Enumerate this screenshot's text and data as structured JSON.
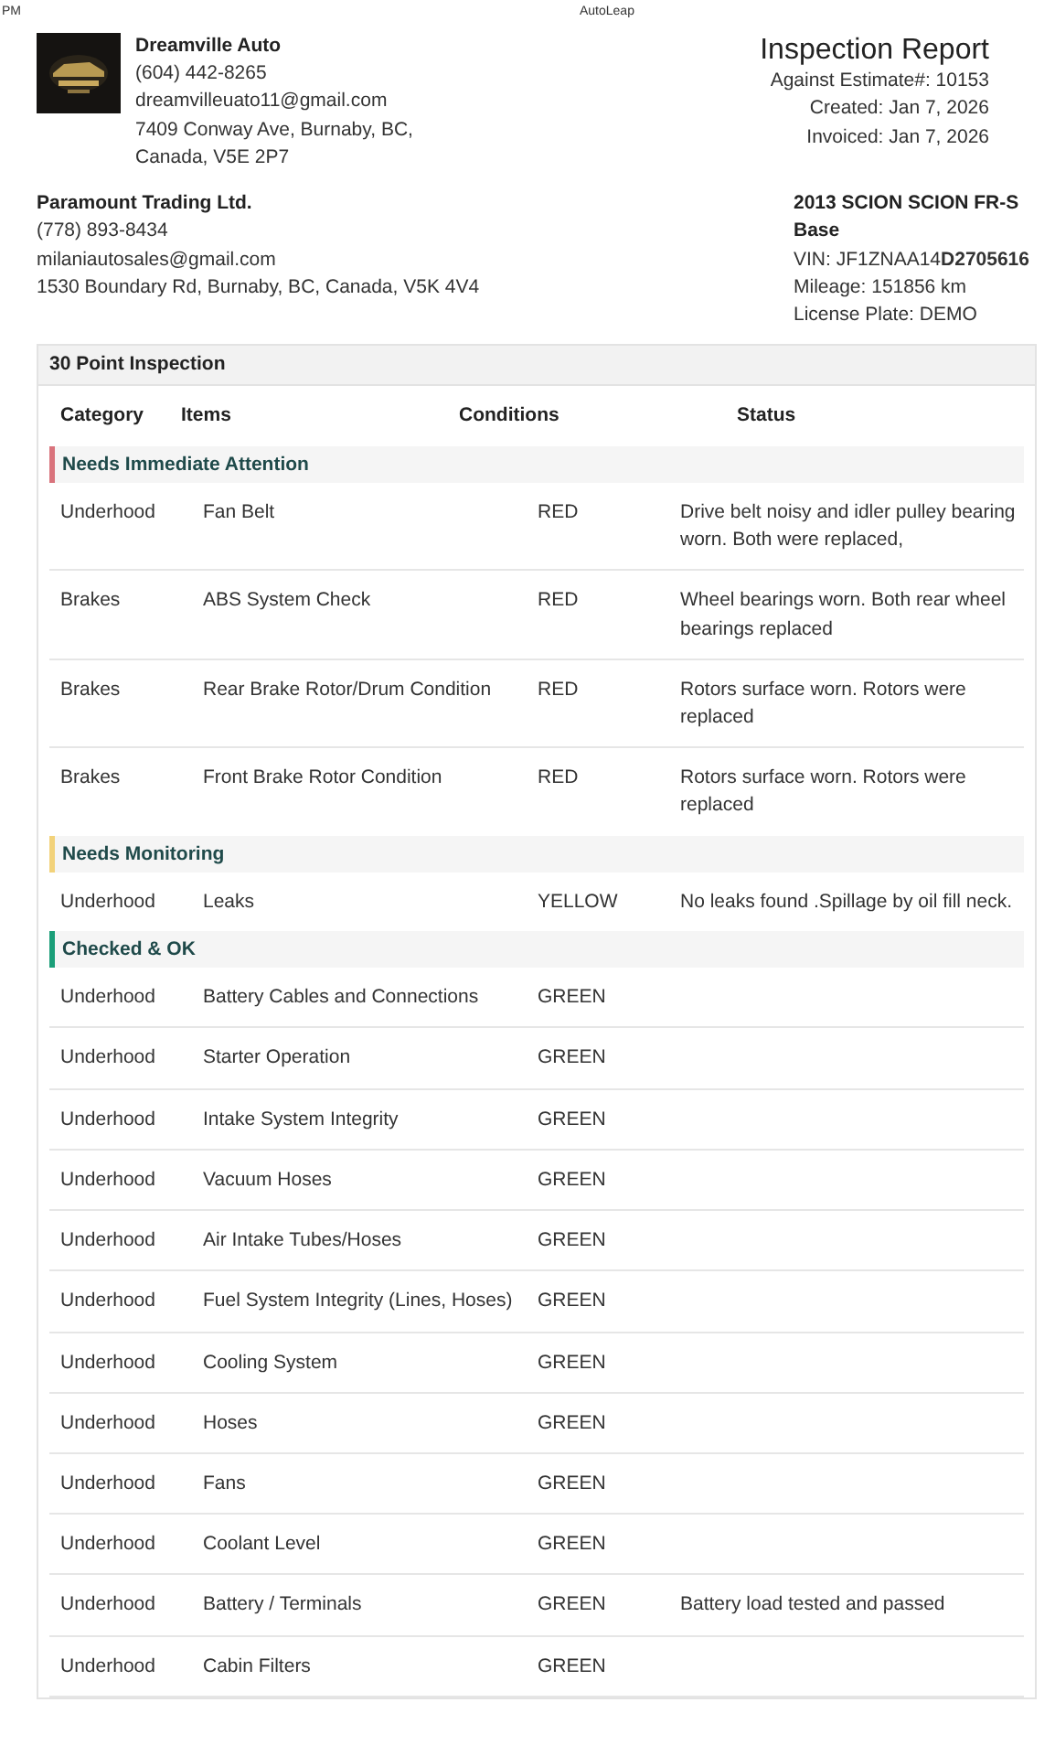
{
  "top_bar": {
    "time": "PM",
    "title": "AutoLeap"
  },
  "shop": {
    "name": "Dreamville Auto",
    "phone": "(604) 442-8265",
    "email": "dreamvilleuato11@gmail.com",
    "address": "7409 Conway Ave, Burnaby, BC, Canada, V5E 2P7"
  },
  "report": {
    "title": "Inspection Report",
    "lines": [
      "Against Estimate#: 10153",
      "Created: Jan 7, 2026",
      "Invoiced: Jan 7, 2026"
    ]
  },
  "customer": {
    "name": "Paramount Trading Ltd.",
    "phone": "(778) 893-8434",
    "email": "milaniautosales@gmail.com",
    "address": "1530 Boundary Rd, Burnaby, BC, Canada, V5K 4V4"
  },
  "vehicle": {
    "name": "2013 SCION SCION FR-S Base",
    "vin": "VIN: JF1ZNAA14**D2705616**",
    "mileage": "Mileage: 151856 km",
    "plate": "License Plate: DEMO"
  },
  "inspection": {
    "title": "30 Point Inspection",
    "columns": [
      "Category",
      "Items",
      "Conditions",
      "Status"
    ],
    "groups": [
      {
        "title": "Needs Immediate Attention",
        "color": "#d9737c",
        "rows": [
          {
            "category": "Underhood",
            "item": "Fan Belt",
            "condition": "RED",
            "status": "Drive belt noisy and idler pulley bearing worn. Both were replaced,"
          },
          {
            "category": "Brakes",
            "item": "ABS System Check",
            "condition": "RED",
            "status": "Wheel bearings worn. Both rear wheel bearings replaced"
          },
          {
            "category": "Brakes",
            "item": "Rear Brake Rotor/Drum Condition",
            "condition": "RED",
            "status": "Rotors surface worn. Rotors were replaced"
          },
          {
            "category": "Brakes",
            "item": "Front Brake Rotor Condition",
            "condition": "RED",
            "status": "Rotors surface worn. Rotors were replaced"
          }
        ]
      },
      {
        "title": "Needs Monitoring",
        "color": "#f2d27a",
        "rows": [
          {
            "category": "Underhood",
            "item": "Leaks",
            "condition": "YELLOW",
            "status": "No leaks found .Spillage by oil fill neck."
          }
        ]
      },
      {
        "title": "Checked & OK",
        "color": "#1a9e78",
        "rows": [
          {
            "category": "Underhood",
            "item": "Battery Cables and Connections",
            "condition": "GREEN"
          },
          {
            "category": "Underhood",
            "item": "Starter Operation",
            "condition": "GREEN"
          },
          {
            "category": "Underhood",
            "item": "Intake System Integrity",
            "condition": "GREEN"
          },
          {
            "category": "Underhood",
            "item": "Vacuum Hoses",
            "condition": "GREEN"
          },
          {
            "category": "Underhood",
            "item": "Air Intake Tubes/Hoses",
            "condition": "GREEN"
          },
          {
            "category": "Underhood",
            "item": "Fuel System Integrity (Lines, Hoses)",
            "condition": "GREEN"
          },
          {
            "category": "Underhood",
            "item": "Cooling System",
            "condition": "GREEN"
          },
          {
            "category": "Underhood",
            "item": "Hoses",
            "condition": "GREEN"
          },
          {
            "category": "Underhood",
            "item": "Fans",
            "condition": "GREEN"
          },
          {
            "category": "Underhood",
            "item": "Coolant Level",
            "condition": "GREEN"
          },
          {
            "category": "Underhood",
            "item": "Battery / Terminals",
            "condition": "GREEN",
            "status": "Battery load tested and passed"
          },
          {
            "category": "Underhood",
            "item": "Cabin Filters",
            "condition": "GREEN"
          }
        ]
      }
    ]
  }
}
